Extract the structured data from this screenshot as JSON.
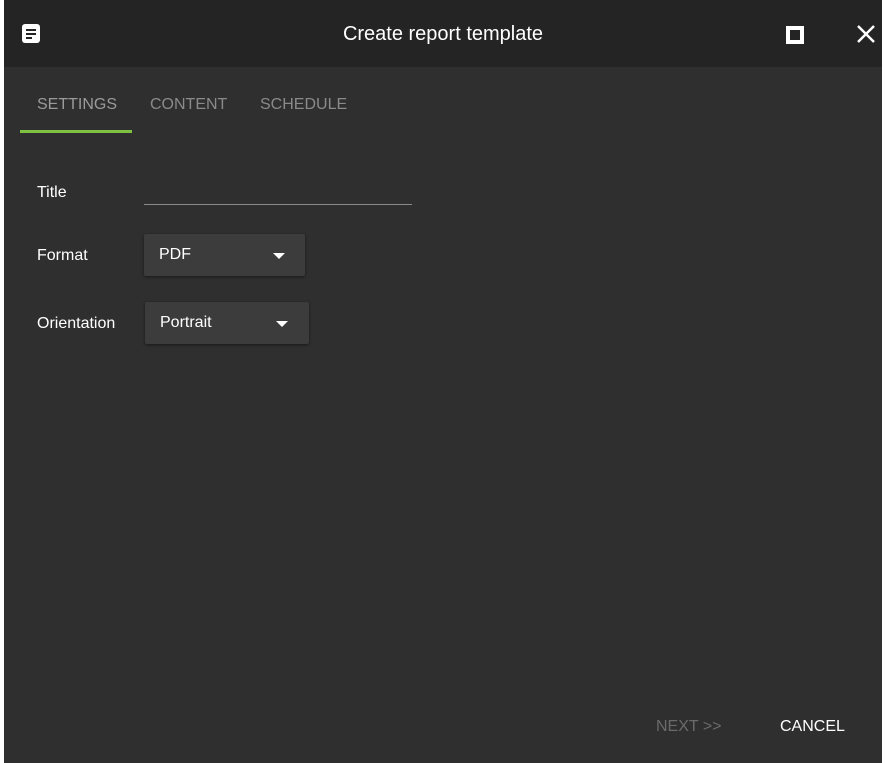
{
  "window": {
    "title": "Create report template",
    "icons": {
      "app": "document-icon",
      "maximize": "maximize-icon",
      "close": "close-icon"
    }
  },
  "tabs": [
    {
      "label": "SETTINGS",
      "active": true
    },
    {
      "label": "CONTENT",
      "active": false
    },
    {
      "label": "SCHEDULE",
      "active": false
    }
  ],
  "form": {
    "title_label": "Title",
    "title_value": "",
    "format_label": "Format",
    "format_value": "PDF",
    "orientation_label": "Orientation",
    "orientation_value": "Portrait"
  },
  "footer": {
    "next_label": "NEXT >>",
    "cancel_label": "CANCEL"
  },
  "colors": {
    "background": "#2f2f2f",
    "titlebar": "#242424",
    "accent": "#7cc142",
    "text": "#ffffff",
    "muted": "#8a8a8a"
  }
}
